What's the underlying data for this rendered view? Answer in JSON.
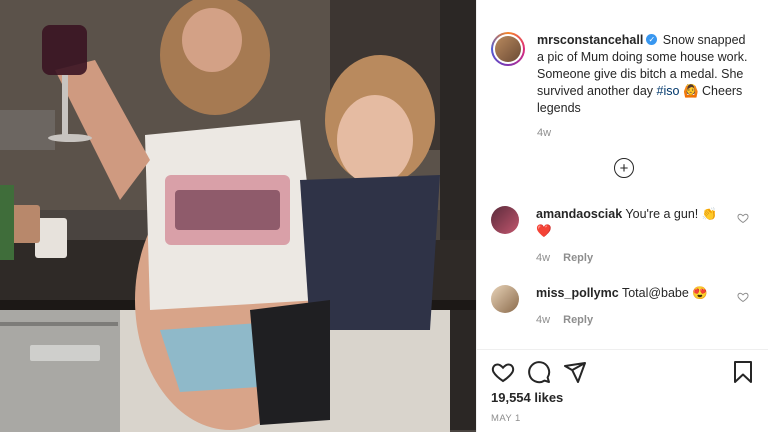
{
  "post": {
    "username": "mrsconstancehall",
    "verified_mark": "✓",
    "caption_main": "Snow snapped a pic of Mum doing some house work. Someone give dis bitch a medal. She survived another day",
    "hashtag": "#iso",
    "caption_emoji": "🙆",
    "caption_end": "Cheers legends",
    "time_ago": "4w",
    "likes": "19,554 likes",
    "date": "MAY 1"
  },
  "load_more_symbol": "+",
  "comments": [
    {
      "username": "amandaosciak",
      "text": "You're a gun!",
      "emoji": "👏",
      "emoji_line2": "❤️",
      "time_ago": "4w",
      "reply_label": "Reply"
    },
    {
      "username": "miss_pollymc",
      "text": "Total@babe",
      "emoji": "😍",
      "time_ago": "4w",
      "reply_label": "Reply"
    }
  ],
  "icons": {
    "like": "heart-icon",
    "comment": "comment-icon",
    "share": "share-icon",
    "save": "bookmark-icon",
    "add": "plus-circle-icon"
  },
  "colors": {
    "text": "#262626",
    "muted": "#8e8e8e",
    "link": "#00376b",
    "verified": "#3897f0"
  }
}
